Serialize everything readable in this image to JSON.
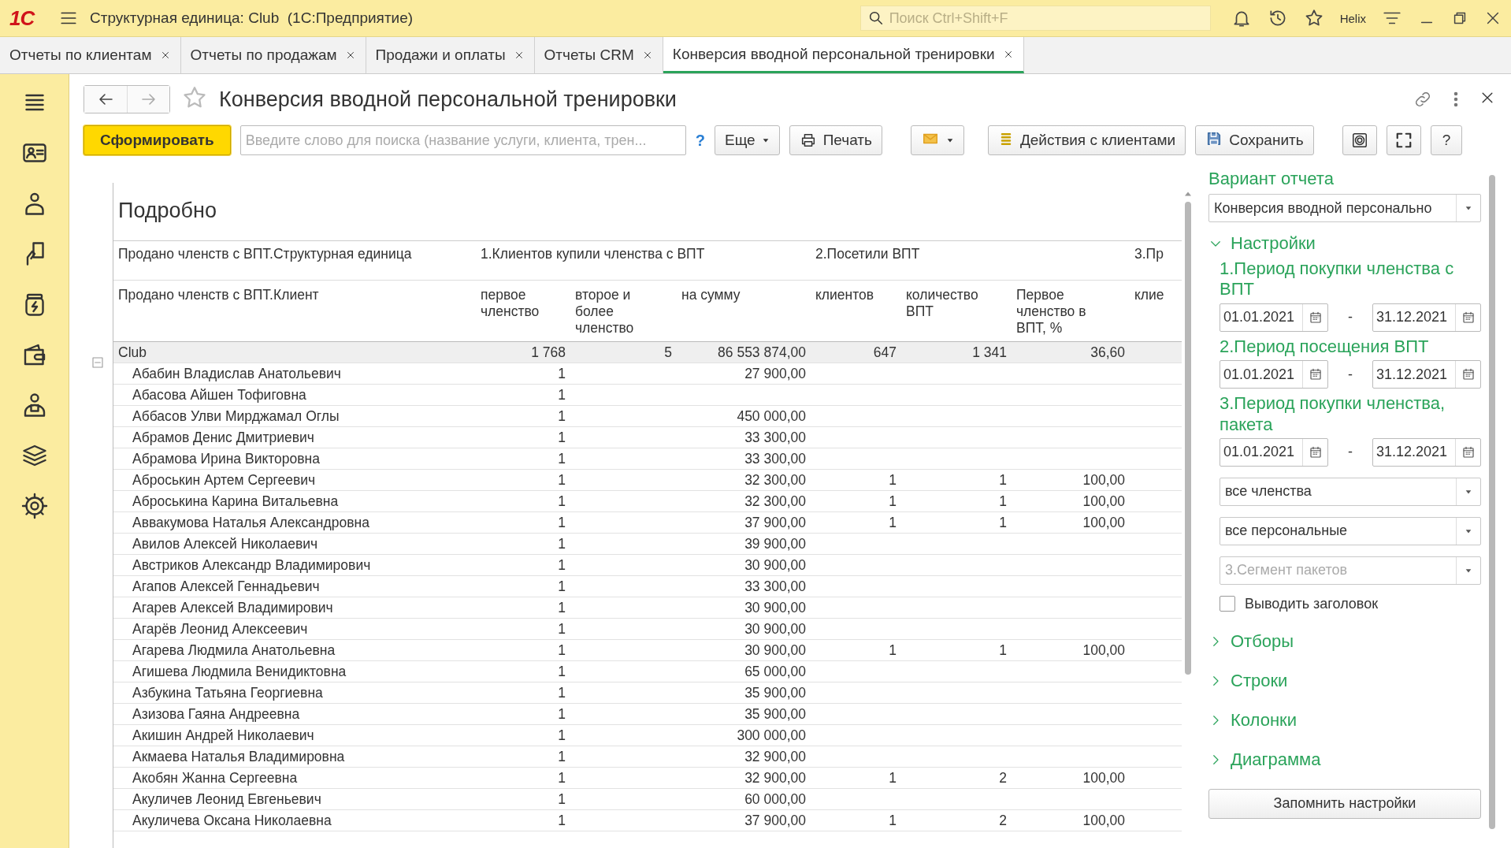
{
  "window": {
    "logo": "1С",
    "title": "Структурная единица: Club  (1С:Предприятие)",
    "search_placeholder": "Поиск Ctrl+Shift+F",
    "user": "Helix"
  },
  "tabs": [
    {
      "label": "Отчеты по клиентам",
      "selected": false
    },
    {
      "label": "Отчеты по продажам",
      "selected": false
    },
    {
      "label": "Продажи и оплаты",
      "selected": false
    },
    {
      "label": "Отчеты CRM",
      "selected": false
    },
    {
      "label": "Конверсия вводной персональной тренировки",
      "selected": true
    }
  ],
  "report": {
    "title": "Конверсия вводной персональной тренировки",
    "toolbar": {
      "generate": "Сформировать",
      "search_placeholder": "Введите слово для поиска (название услуги, клиента, трен...",
      "search_help": "?",
      "more": "Еще",
      "print": "Печать",
      "client_actions": "Действия с клиентами",
      "save": "Сохранить",
      "help": "?"
    },
    "section_title": "Подробно",
    "group_headers": [
      "Продано членств с ВПТ.Структурная единица",
      "1.Клиентов купили членства с ВПТ",
      "2.Посетили ВПТ",
      "3.Пр"
    ],
    "columns": [
      "Продано членств с ВПТ.Клиент",
      "первое членство",
      "второе и более членство",
      "на сумму",
      "клиентов",
      "количество ВПТ",
      "Первое членство в ВПТ, %",
      "клие"
    ],
    "total": {
      "name": "Club",
      "expanded": true,
      "cells": [
        "1 768",
        "5",
        "86 553 874,00",
        "647",
        "1 341",
        "36,60"
      ],
      "children": [
        {
          "name": "Абабин Владислав Анатольевич",
          "cells": [
            "1",
            "",
            "27 900,00",
            "",
            "",
            ""
          ]
        },
        {
          "name": "Абасова Айшен Тофиговна",
          "cells": [
            "1",
            "",
            "",
            "",
            "",
            ""
          ]
        },
        {
          "name": "Аббасов Улви Мирджамал Оглы",
          "cells": [
            "1",
            "",
            "450 000,00",
            "",
            "",
            ""
          ]
        },
        {
          "name": "Абрамов Денис Дмитриевич",
          "cells": [
            "1",
            "",
            "33 300,00",
            "",
            "",
            ""
          ]
        },
        {
          "name": "Абрамова Ирина Викторовна",
          "cells": [
            "1",
            "",
            "33 300,00",
            "",
            "",
            ""
          ]
        },
        {
          "name": "Аброськин Артем Сергеевич",
          "cells": [
            "1",
            "",
            "32 300,00",
            "1",
            "1",
            "100,00"
          ]
        },
        {
          "name": "Аброськина Карина Витальевна",
          "cells": [
            "1",
            "",
            "32 300,00",
            "1",
            "1",
            "100,00"
          ]
        },
        {
          "name": "Аввакумова Наталья Александровна",
          "cells": [
            "1",
            "",
            "37 900,00",
            "1",
            "1",
            "100,00"
          ]
        },
        {
          "name": "Авилов Алексей Николаевич",
          "cells": [
            "1",
            "",
            "39 900,00",
            "",
            "",
            ""
          ]
        },
        {
          "name": "Австриков Александр Владимирович",
          "cells": [
            "1",
            "",
            "30 900,00",
            "",
            "",
            ""
          ]
        },
        {
          "name": "Агапов Алексей Геннадьевич",
          "cells": [
            "1",
            "",
            "33 300,00",
            "",
            "",
            ""
          ]
        },
        {
          "name": "Агарев Алексей Владимирович",
          "cells": [
            "1",
            "",
            "30 900,00",
            "",
            "",
            ""
          ]
        },
        {
          "name": "Агарёв Леонид Алексеевич",
          "cells": [
            "1",
            "",
            "30 900,00",
            "",
            "",
            ""
          ]
        },
        {
          "name": "Агарева Людмила Анатольевна",
          "cells": [
            "1",
            "",
            "30 900,00",
            "1",
            "1",
            "100,00"
          ]
        },
        {
          "name": "Агишева Людмила Венидиктовна",
          "cells": [
            "1",
            "",
            "65 000,00",
            "",
            "",
            ""
          ]
        },
        {
          "name": "Азбукина Татьяна Георгиевна",
          "cells": [
            "1",
            "",
            "35 900,00",
            "",
            "",
            ""
          ]
        },
        {
          "name": "Азизова Гаяна Андреевна",
          "cells": [
            "1",
            "",
            "35 900,00",
            "",
            "",
            ""
          ]
        },
        {
          "name": "Акишин Андрей Николаевич",
          "cells": [
            "1",
            "",
            "300 000,00",
            "",
            "",
            ""
          ]
        },
        {
          "name": "Акмаева Наталья Владимировна",
          "cells": [
            "1",
            "",
            "32 900,00",
            "",
            "",
            ""
          ]
        },
        {
          "name": "Акобян Жанна Сергеевна",
          "cells": [
            "1",
            "",
            "32 900,00",
            "1",
            "2",
            "100,00"
          ]
        },
        {
          "name": "Акуличев Леонид Евгеньевич",
          "cells": [
            "1",
            "",
            "60 000,00",
            "",
            "",
            ""
          ]
        },
        {
          "name": "Акуличева Оксана Николаевна",
          "cells": [
            "1",
            "",
            "37 900,00",
            "1",
            "2",
            "100,00"
          ]
        }
      ]
    }
  },
  "settings": {
    "variant_label": "Вариант отчета",
    "variant_value": "Конверсия вводной персонально",
    "group": {
      "label": "Настройки",
      "expanded": true
    },
    "periods": [
      {
        "label": "1.Период покупки членства с ВПТ",
        "from": "01.01.2021",
        "separator": "-",
        "to": "31.12.2021"
      },
      {
        "label": "2.Период посещения ВПТ",
        "from": "01.01.2021",
        "separator": "-",
        "to": "31.12.2021"
      },
      {
        "label": "3.Период покупки членства, пакета",
        "from": "01.01.2021",
        "separator": "-",
        "to": "31.12.2021"
      }
    ],
    "selects": [
      {
        "value": "все членства"
      },
      {
        "value": "все персональные"
      },
      {
        "placeholder": "3.Сегмент пакетов"
      }
    ],
    "checkbox": {
      "label": "Выводить заголовок",
      "checked": false
    },
    "sections": [
      {
        "label": "Отборы",
        "expanded": false
      },
      {
        "label": "Строки",
        "expanded": false
      },
      {
        "label": "Колонки",
        "expanded": false
      },
      {
        "label": "Диаграмма",
        "expanded": false
      }
    ],
    "save_button": "Запомнить настройки"
  }
}
